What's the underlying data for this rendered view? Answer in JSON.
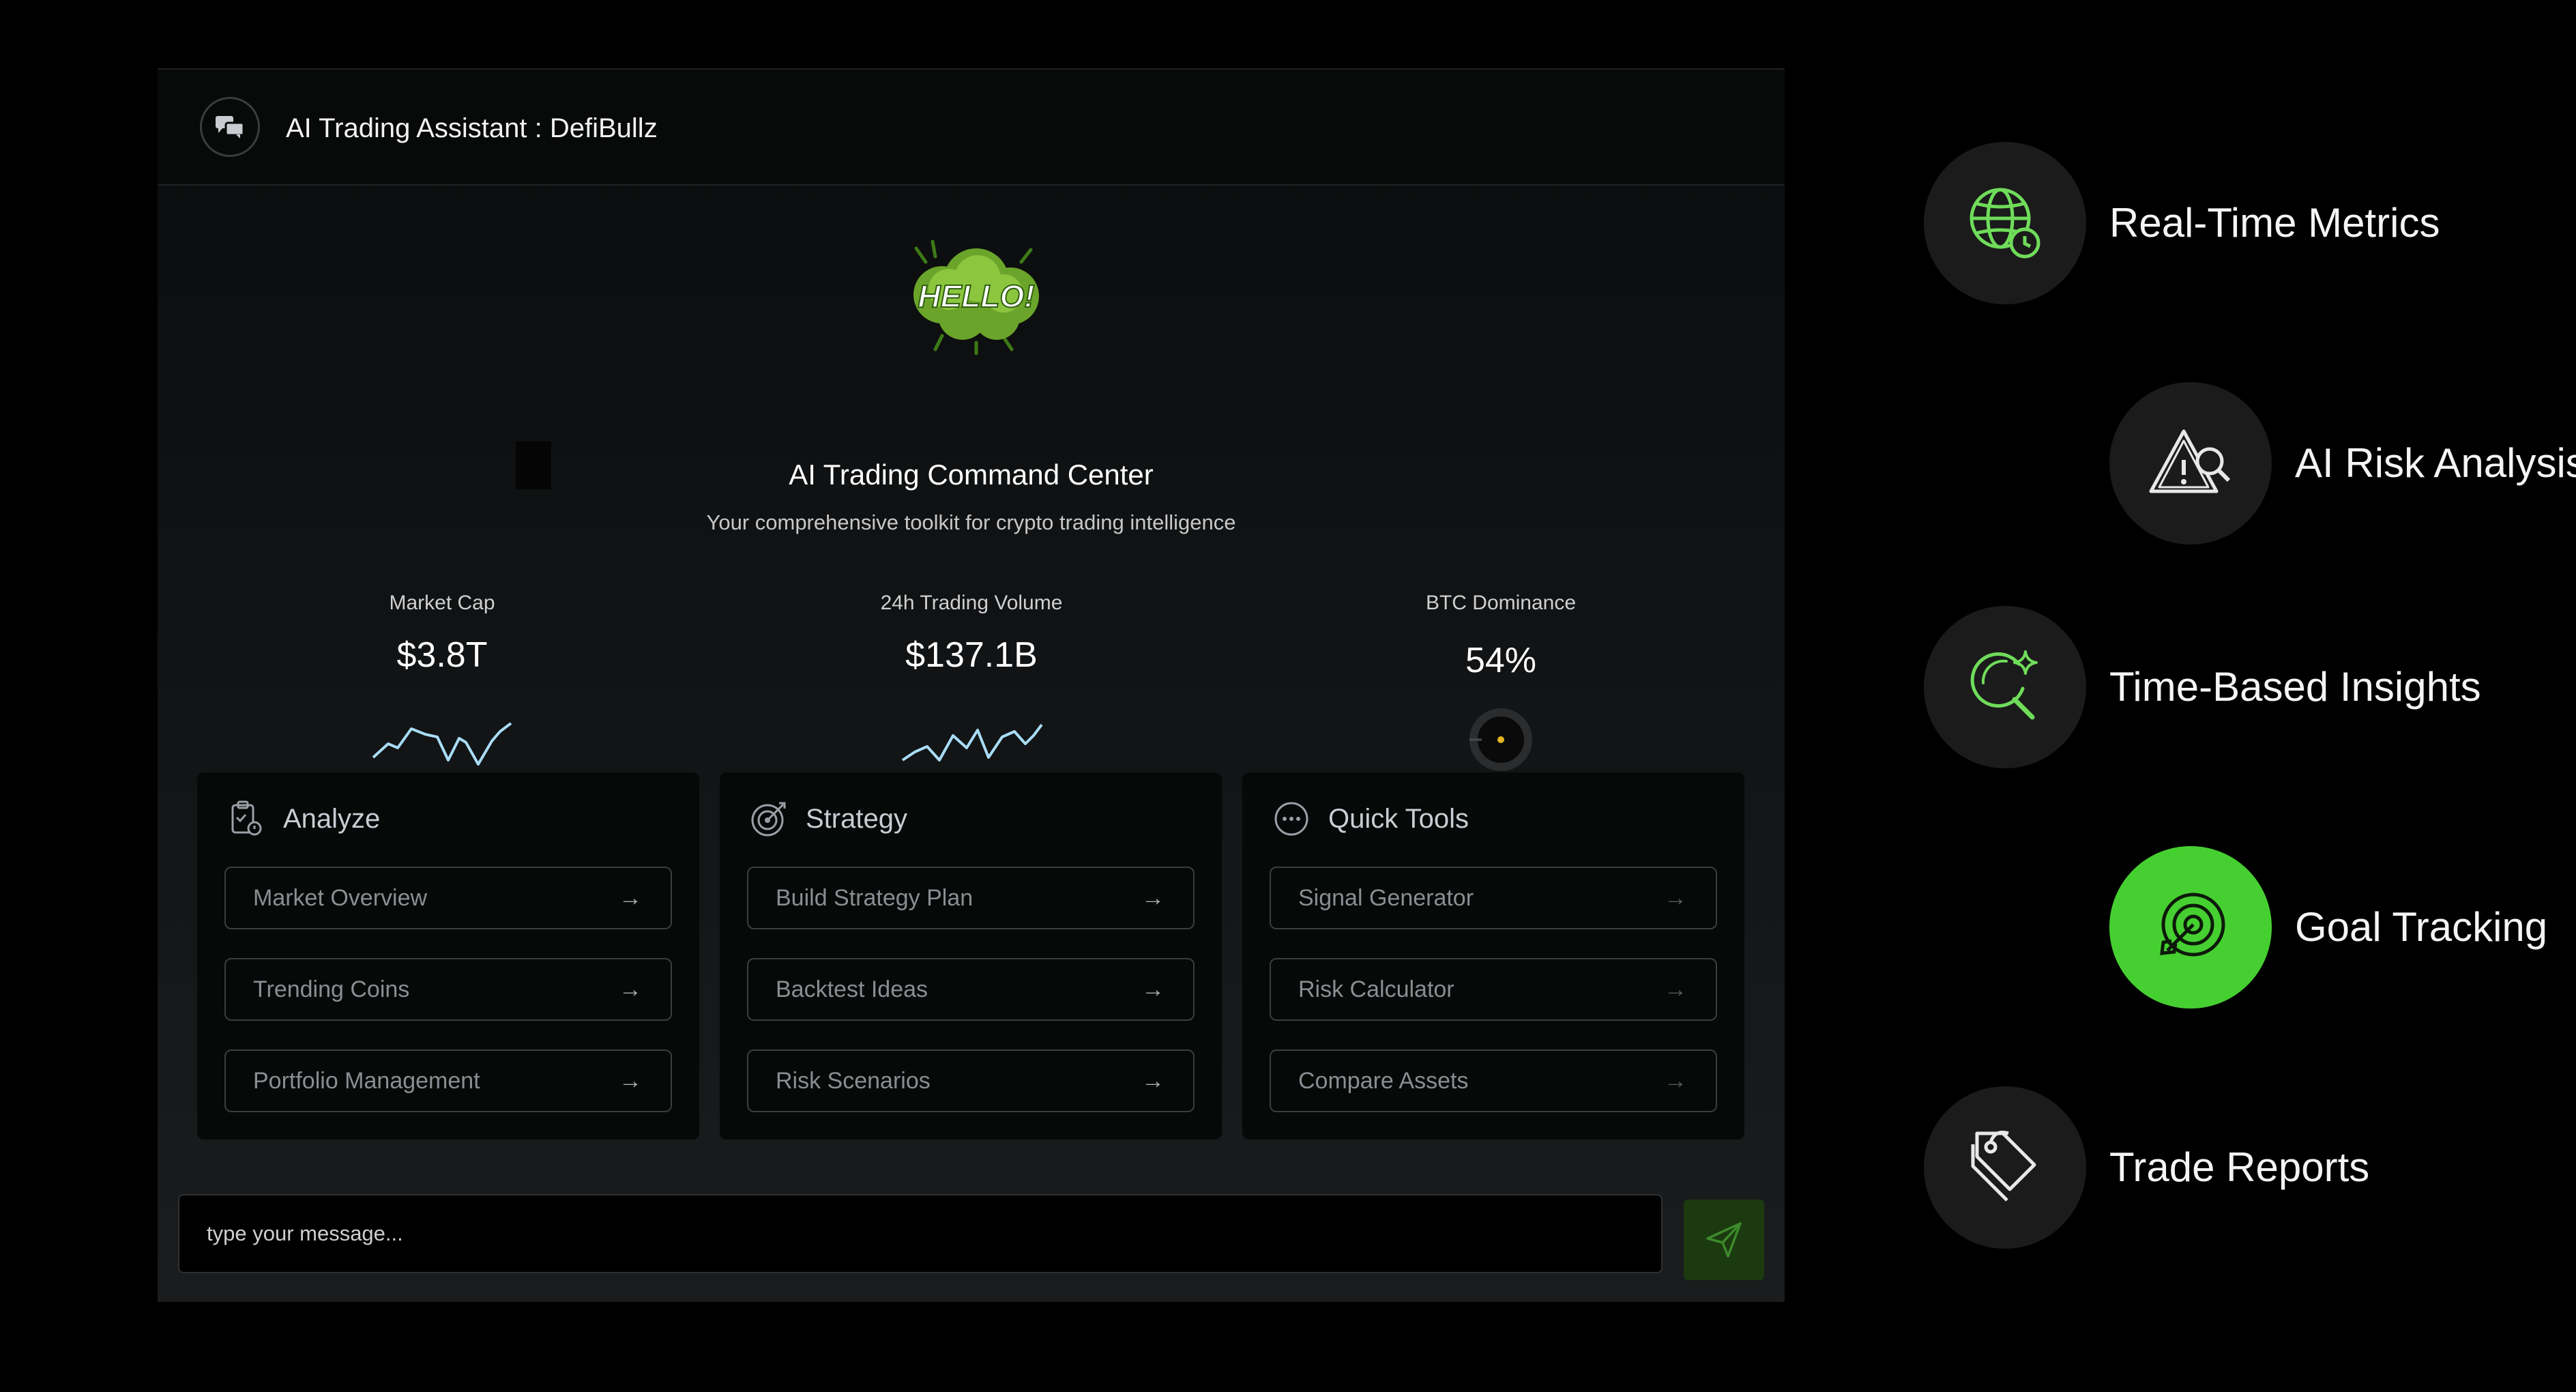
{
  "header": {
    "title": "AI Trading Assistant : DefiBullz",
    "icon": "chat-bubbles-icon"
  },
  "hero": {
    "badge_text": "HELLO!",
    "title": "AI Trading Command Center",
    "subtitle": "Your comprehensive toolkit for crypto trading intelligence"
  },
  "stats": [
    {
      "label": "Market Cap",
      "value": "$3.8T",
      "visual": "sparkline"
    },
    {
      "label": "24h Trading Volume",
      "value": "$137.1B",
      "visual": "sparkline"
    },
    {
      "label": "BTC Dominance",
      "value": "54%",
      "visual": "gauge"
    }
  ],
  "cards": [
    {
      "title": "Analyze",
      "icon": "analyze-icon",
      "items": [
        "Market Overview",
        "Trending Coins",
        "Portfolio Management"
      ]
    },
    {
      "title": "Strategy",
      "icon": "target-icon",
      "items": [
        "Build Strategy Plan",
        "Backtest Ideas",
        "Risk Scenarios"
      ]
    },
    {
      "title": "Quick Tools",
      "icon": "dots-circle-icon",
      "items": [
        "Signal Generator",
        "Risk Calculator",
        "Compare Assets"
      ]
    }
  ],
  "arrow_glyph": "→",
  "composer": {
    "placeholder": "type your message..."
  },
  "features": [
    {
      "label": "Real-Time Metrics",
      "icon": "globe-clock-icon",
      "active": false
    },
    {
      "label": "AI Risk Analysis",
      "icon": "warning-search-icon",
      "active": false
    },
    {
      "label": "Time-Based Insights",
      "icon": "search-sparkle-icon",
      "active": false
    },
    {
      "label": "Goal Tracking",
      "icon": "target-arrow-icon",
      "active": true
    },
    {
      "label": "Trade Reports",
      "icon": "tags-icon",
      "active": false
    }
  ],
  "colors": {
    "accent_green": "#46cf31",
    "icon_green": "#6fdc5a",
    "sparkline": "#a9dcf5",
    "send_button": "#1b3a10"
  }
}
